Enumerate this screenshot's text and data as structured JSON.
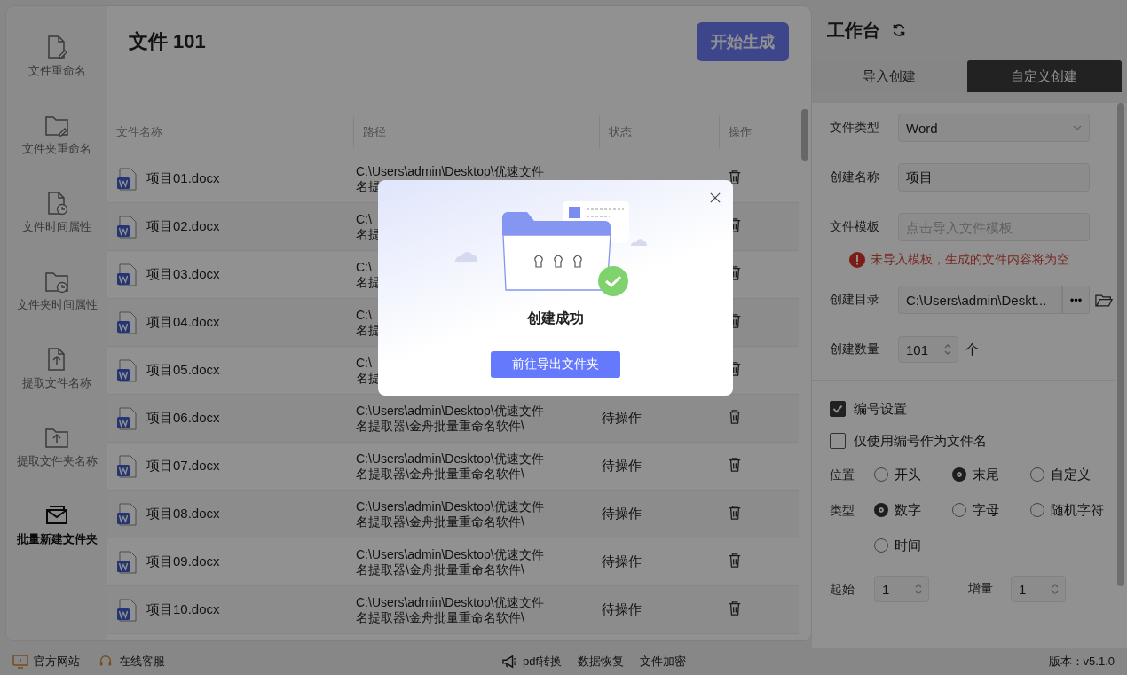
{
  "sidebar": {
    "items": [
      {
        "label": "文件重命名",
        "kind": "file-pen",
        "selected": false
      },
      {
        "label": "文件夹重命名",
        "kind": "folder-pen",
        "selected": false
      },
      {
        "label": "文件时间属性",
        "kind": "file-clock",
        "selected": false
      },
      {
        "label": "文件夹时间属性",
        "kind": "folder-clock",
        "selected": false
      },
      {
        "label": "提取文件名称",
        "kind": "file-up",
        "selected": false
      },
      {
        "label": "提取文件夹名称",
        "kind": "folder-up",
        "selected": false
      },
      {
        "label": "批量新建文件夹",
        "kind": "envelope",
        "selected": true
      }
    ]
  },
  "main": {
    "title": "文件 101",
    "start_button": "开始生成"
  },
  "table": {
    "columns": [
      "文件名称",
      "路径",
      "状态",
      "操作"
    ],
    "rows": [
      {
        "name": "项目01.docx",
        "path": [
          "C:\\Users\\admin\\Desktop\\优速文件",
          "名提"
        ]
      },
      {
        "name": "项目02.docx",
        "path": [
          "C:\\",
          "名提"
        ]
      },
      {
        "name": "项目03.docx",
        "path": [
          "C:\\",
          "名提"
        ]
      },
      {
        "name": "项目04.docx",
        "path": [
          "C:\\",
          "名提"
        ]
      },
      {
        "name": "项目05.docx",
        "path": [
          "C:\\",
          "名提"
        ]
      },
      {
        "name": "项目06.docx",
        "path": [
          "C:\\Users\\admin\\Desktop\\优速文件",
          "名提取器\\金舟批量重命名软件\\"
        ],
        "status": "待操作"
      },
      {
        "name": "项目07.docx",
        "path": [
          "C:\\Users\\admin\\Desktop\\优速文件",
          "名提取器\\金舟批量重命名软件\\"
        ],
        "status": "待操作"
      },
      {
        "name": "项目08.docx",
        "path": [
          "C:\\Users\\admin\\Desktop\\优速文件",
          "名提取器\\金舟批量重命名软件\\"
        ],
        "status": "待操作"
      },
      {
        "name": "项目09.docx",
        "path": [
          "C:\\Users\\admin\\Desktop\\优速文件",
          "名提取器\\金舟批量重命名软件\\"
        ],
        "status": "待操作"
      },
      {
        "name": "项目10.docx",
        "path": [
          "C:\\Users\\admin\\Desktop\\优速文件",
          "名提取器\\金舟批量重命名软件\\"
        ],
        "status": "待操作"
      }
    ]
  },
  "workbench": {
    "title": "工作台",
    "tabs": [
      {
        "label": "导入创建",
        "selected": false
      },
      {
        "label": "自定义创建",
        "selected": true
      }
    ],
    "file_type": {
      "label": "文件类型",
      "value": "Word"
    },
    "create_name": {
      "label": "创建名称",
      "value": "项目"
    },
    "template": {
      "label": "文件模板",
      "placeholder": "点击导入文件模板"
    },
    "warning": "未导入模板，生成的文件内容将为空",
    "directory": {
      "label": "创建目录",
      "value": "C:\\Users\\admin\\Deskt...",
      "more": "•••"
    },
    "count": {
      "label": "创建数量",
      "value": "101",
      "unit": "个"
    },
    "checkboxes": [
      {
        "label": "编号设置",
        "checked": true
      },
      {
        "label": "仅使用编号作为文件名",
        "checked": false
      }
    ],
    "position": {
      "label": "位置",
      "options": [
        {
          "label": "开头",
          "selected": false
        },
        {
          "label": "末尾",
          "selected": true
        },
        {
          "label": "自定义",
          "selected": false
        }
      ]
    },
    "type": {
      "label": "类型",
      "options": [
        {
          "label": "数字",
          "selected": true
        },
        {
          "label": "字母",
          "selected": false
        },
        {
          "label": "随机字符",
          "selected": false
        },
        {
          "label": "时间",
          "selected": false
        }
      ]
    },
    "start": {
      "label": "起始",
      "value": "1"
    },
    "increment": {
      "label": "增量",
      "value": "1"
    }
  },
  "footer": {
    "left": [
      {
        "label": "官方网站",
        "kind": "monitor"
      },
      {
        "label": "在线客服",
        "kind": "headset"
      }
    ],
    "center": [
      {
        "label": "pdf转换",
        "kind": "megaphone"
      },
      {
        "label": "数据恢复",
        "kind": "plain"
      },
      {
        "label": "文件加密",
        "kind": "plain"
      }
    ],
    "version": "版本：v5.1.0"
  },
  "modal": {
    "title": "创建成功",
    "button": "前往导出文件夹"
  }
}
